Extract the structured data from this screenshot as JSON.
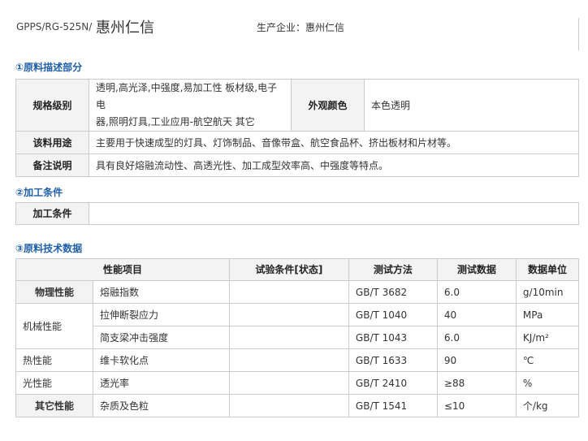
{
  "header": {
    "product_code": "GPPS/RG-525N/",
    "brand": "惠州仁信",
    "manufacturer_label": "生产企业：",
    "manufacturer_value": "惠州仁信"
  },
  "sections": {
    "desc_title": "①原料描述部分",
    "process_title": "②加工条件",
    "tech_title": "③原料技术数据"
  },
  "description": {
    "spec_label": "规格级别",
    "spec_value_line1": "透明,高光泽,中强度,易加工性 板材级,电子电",
    "spec_value_line2": "器,照明灯具,工业应用-航空航天 其它",
    "appearance_label": "外观颜色",
    "appearance_value": "本色透明",
    "use_label": "该料用途",
    "use_value": "主要用于快速成型的灯具、灯饰制品、音像带盒、航空食品杯、挤出板材和片材等。",
    "note_label": "备注说明",
    "note_value": "具有良好熔融流动性、高透光性、加工成型效率高、中强度等特点。"
  },
  "processing": {
    "label": "加工条件",
    "value": ""
  },
  "tech": {
    "headers": [
      "性能项目",
      "试验条件[状态]",
      "测试方法",
      "测试数据",
      "数据单位"
    ],
    "rows": [
      {
        "category": "物理性能",
        "item": "熔融指数",
        "condition": "",
        "method": "GB/T 3682",
        "data": "6.0",
        "unit": "g/10min"
      },
      {
        "category": "机械性能",
        "item": "拉伸断裂应力",
        "condition": "",
        "method": "GB/T 1040",
        "data": "40",
        "unit": "MPa"
      },
      {
        "category": "",
        "item": "简支梁冲击强度",
        "condition": "",
        "method": "GB/T 1043",
        "data": "6.0",
        "unit": "KJ/m²"
      },
      {
        "category": "热性能",
        "item": "维卡软化点",
        "condition": "",
        "method": "GB/T 1633",
        "data": "90",
        "unit": "℃"
      },
      {
        "category": "光性能",
        "item": "透光率",
        "condition": "",
        "method": "GB/T 2410",
        "data": "≥88",
        "unit": "%"
      },
      {
        "category": "其它性能",
        "item": "杂质及色粒",
        "condition": "",
        "method": "GB/T 1541",
        "data": "≤10",
        "unit": "个/kg"
      }
    ]
  }
}
